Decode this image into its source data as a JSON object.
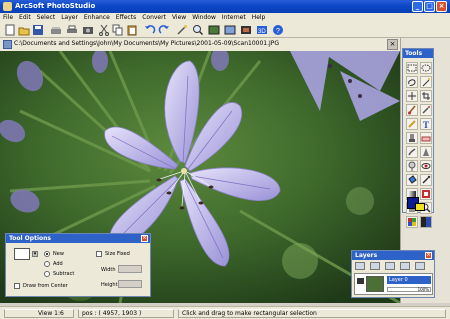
{
  "window": {
    "title": "ArcSoft PhotoStudio"
  },
  "menu": [
    "File",
    "Edit",
    "Select",
    "Layer",
    "Enhance",
    "Effects",
    "Convert",
    "View",
    "Window",
    "Internet",
    "Help"
  ],
  "toolbar_icons": [
    "new-icon",
    "open-icon",
    "save-icon",
    "scan-icon",
    "print-icon",
    "cut-icon",
    "copy-icon",
    "paste-icon",
    "undo-icon",
    "redo-icon",
    "magic-icon",
    "zoom-icon",
    "album-icon",
    "edit-icon",
    "effects-icon",
    "web-icon",
    "help-icon"
  ],
  "document": {
    "path": "C:\\Documents and Settings\\John\\My Documents\\My Pictures\\2001-05-09\\Scan10001.JPG"
  },
  "tools_panel": {
    "title": "Tools"
  },
  "tool_options": {
    "title": "Tool Options",
    "new_label": "New",
    "add_label": "Add",
    "subtract_label": "Subtract",
    "draw_from_center": "Draw from Center",
    "size_fixed": "Size Fixed",
    "width_label": "Width",
    "height_label": "Height"
  },
  "layers": {
    "title": "Layers",
    "layer_name": "Layer 0",
    "opacity": "100%"
  },
  "status": {
    "view": "View 1:6",
    "pos": "pos : ( 4957, 1903 )",
    "hint": "Click and drag to make rectangular selection"
  },
  "colors": {
    "accent": "#2f62c8",
    "chrome": "#ece9d8",
    "flower": "#b9b4e6"
  }
}
